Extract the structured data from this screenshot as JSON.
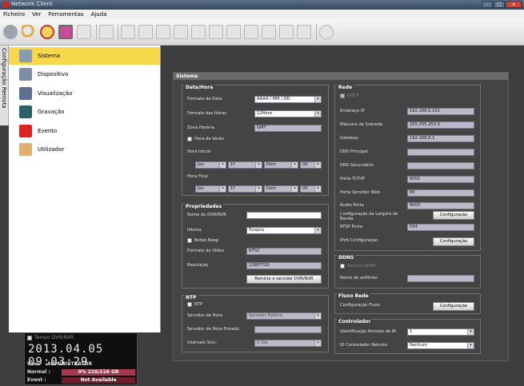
{
  "window": {
    "title": "Network Client",
    "minimize": "–",
    "maximize": "□",
    "close": "x"
  },
  "menu": [
    "Ficheiro",
    "Ver",
    "Ferramentas",
    "Ajuda"
  ],
  "sidetab": "Configuração Remota",
  "nav": [
    {
      "label": "Sistema",
      "selected": true,
      "icon": "system-icon",
      "color": "#8a9bb0"
    },
    {
      "label": "Dispositivo",
      "selected": false,
      "icon": "device-icon",
      "color": "#7e8fa5"
    },
    {
      "label": "Visualização",
      "selected": false,
      "icon": "view-icon",
      "color": "#5f6f94"
    },
    {
      "label": "Gravação",
      "selected": false,
      "icon": "record-icon",
      "color": "#2a5f6a"
    },
    {
      "label": "Evento",
      "selected": false,
      "icon": "alarm-icon",
      "color": "#d9251d"
    },
    {
      "label": "Utilizador",
      "selected": false,
      "icon": "user-icon",
      "color": "#e0b070"
    }
  ],
  "clock": {
    "label": "Tempo DVR/NVR",
    "datetime": "2013.04.05 09:03:29",
    "user_label": "User",
    "user_value": "ADMINISTRATOR",
    "normal_label": "Normal :",
    "normal_value": "0% 226/226 GB",
    "event_label": "Event :",
    "event_value": "Not Available"
  },
  "main": {
    "header": "Sistema",
    "datahora": {
      "title": "Data/Hora",
      "formato_data_label": "Formato da Data",
      "formato_data_value": "AAAA / MM / DD",
      "formato_horas_label": "Formato das Horas",
      "formato_horas_value": "12Hora",
      "zona_label": "Zona Horária",
      "zona_value": "GMT",
      "verao_label": "Hora de Verão",
      "inicial_label": "Hora Inicial",
      "final_label": "Hora Final",
      "inicial": [
        "Jan",
        "1ª",
        "Dom",
        "00"
      ],
      "final": [
        "Jan",
        "1ª",
        "Dom",
        "00"
      ]
    },
    "propriedades": {
      "title": "Propriedades",
      "nome_label": "Nome do DVR/NVR",
      "nome_value": "",
      "idioma_label": "Idioma",
      "idioma_value": "Turquia",
      "beep_label": "Botão Beep",
      "video_label": "Formato de Vídeo",
      "video_value": "NTSC",
      "res_label": "Resolução",
      "res_value": "1280*720",
      "restart_button": "Reinicie o servidor DVR/NVR"
    },
    "ntp": {
      "title": "NTP",
      "ntp_label": "NTP",
      "servidor_label": "Servidor de Hora",
      "servidor_value": "Servidor Público",
      "privado_label": "Servidor de Hora Privado",
      "privado_value": "",
      "intervalo_label": "Intervalo Sinc.",
      "intervalo_value": "1 Dia"
    },
    "rede": {
      "title": "Rede",
      "dhcp_label": "DHCP",
      "rows": [
        {
          "label": "Endereço IP",
          "value": "192.168.0.101"
        },
        {
          "label": "Máscara de Subrede",
          "value": "255.255.255.0"
        },
        {
          "label": "Gateway",
          "value": "192.168.0.1"
        },
        {
          "label": "DNS Principal",
          "value": ""
        },
        {
          "label": "DNS Secundário",
          "value": ""
        },
        {
          "label": "Porta TCP/IP",
          "value": "9001"
        },
        {
          "label": "Porta Servidor Web",
          "value": "80"
        },
        {
          "label": "Áudio Porta",
          "value": "9003"
        }
      ],
      "banda_label": "Configuração da Largura de Banda",
      "banda_button": "Configuração",
      "rtsp_label": "RTSP Porta",
      "rtsp_value": "554",
      "ipv6_label": "IPv6 Configuração",
      "ipv6_button": "Configuração"
    },
    "ddns": {
      "title": "DDNS",
      "servico_label": "Serviço DDNS",
      "anfitriao_label": "Nome de anfitrião",
      "anfitriao_value": ""
    },
    "fluxo": {
      "title": "Fluxo Rede",
      "label": "Configuração Fluxo",
      "button": "Configuração"
    },
    "controlador": {
      "title": "Controlador",
      "ir_label": "Identificação Remota de IR",
      "ir_value": "1",
      "id_label": "ID Controlador Remoto",
      "id_value": "Nenhum"
    }
  }
}
